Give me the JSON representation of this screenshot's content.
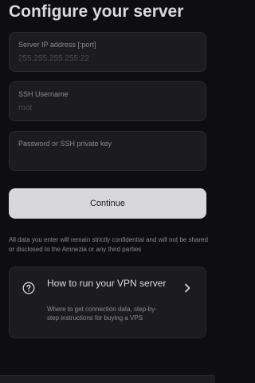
{
  "page": {
    "title": "Configure your server"
  },
  "fields": {
    "server_ip": {
      "label": "Server IP address [:port]",
      "placeholder": "255.255.255.255:22",
      "value": ""
    },
    "ssh_username": {
      "label": "SSH Username",
      "placeholder": "root",
      "value": ""
    },
    "password": {
      "label": "Password or SSH private key",
      "value": ""
    }
  },
  "continue_button": {
    "label": "Continue"
  },
  "disclaimer": {
    "text": "All data you enter will remain strictly confidential and will not be shared or disclosed to the Amnezia or any third parties"
  },
  "help_card": {
    "icon": "question-circle-icon",
    "title": "How to run your VPN server",
    "description": "Where to get connection data, step-by-step instructions for buying a VPS",
    "chevron_icon": "chevron-right-icon"
  },
  "colors": {
    "background": "#0e0e11",
    "field_background": "#1c1c20",
    "button_background": "#d8d8da",
    "primary_text": "#dadadf",
    "secondary_text": "#8a8a91"
  }
}
